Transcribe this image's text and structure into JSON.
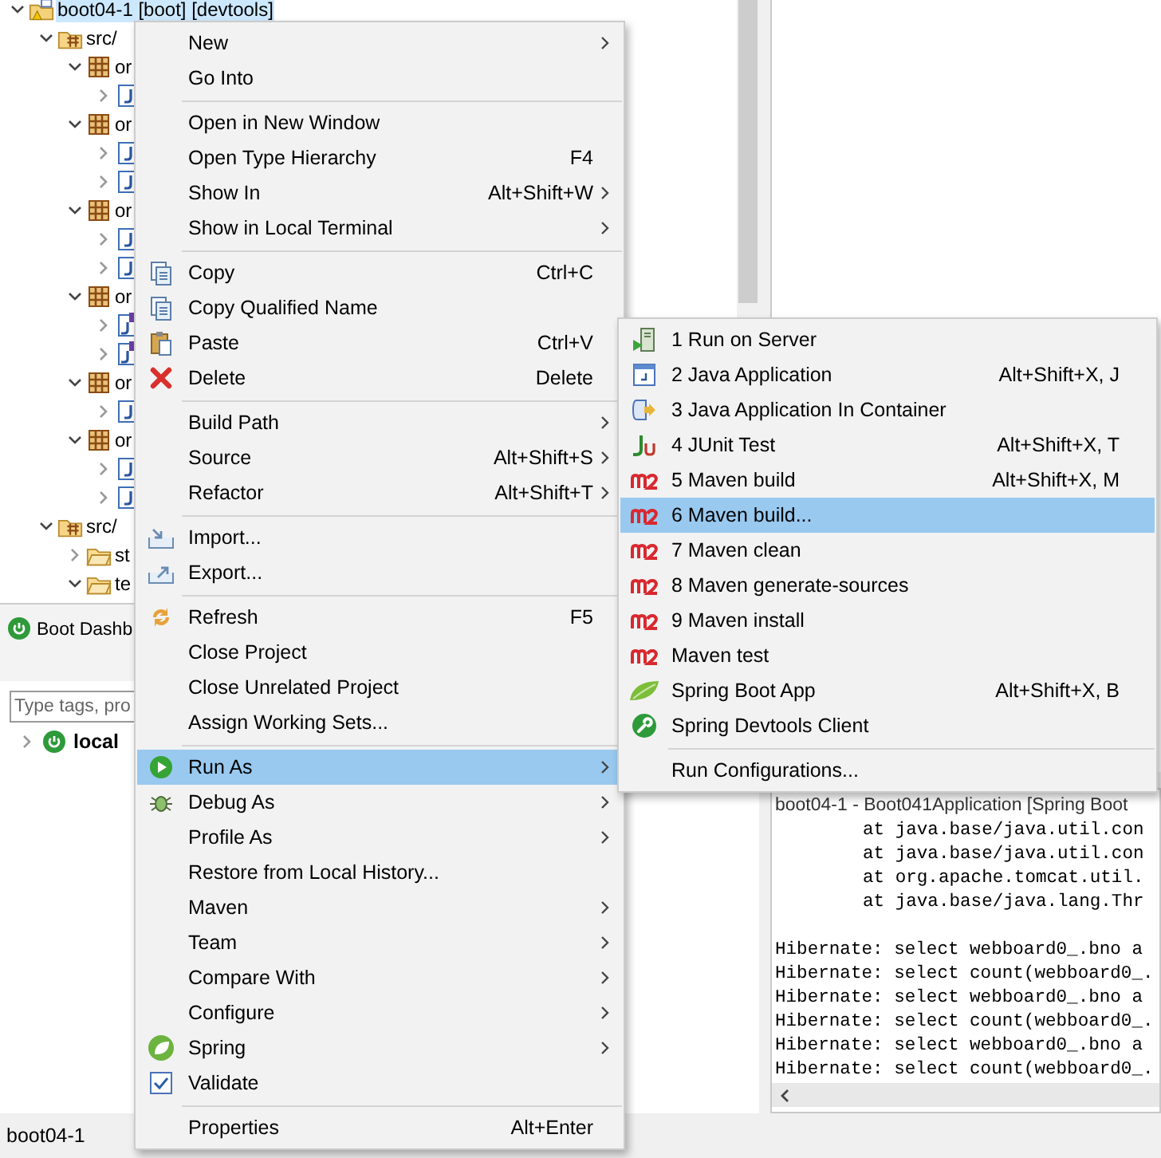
{
  "explorer": {
    "tree": [
      {
        "kind": "project",
        "label": "boot04-1 [boot] [devtools]",
        "selected": true,
        "expanded": true,
        "children": [
          {
            "kind": "source-folder",
            "label": "src/",
            "selected": false,
            "expanded": true,
            "children": [
              {
                "kind": "package",
                "label": "or",
                "selected": false,
                "expanded": true,
                "children": [
                  {
                    "kind": "class",
                    "expanded": false
                  }
                ]
              },
              {
                "kind": "package",
                "label": "or",
                "selected": false,
                "expanded": true,
                "children": [
                  {
                    "kind": "class",
                    "expanded": false
                  },
                  {
                    "kind": "class",
                    "expanded": false
                  }
                ]
              },
              {
                "kind": "package",
                "label": "or",
                "selected": false,
                "expanded": true,
                "children": [
                  {
                    "kind": "class",
                    "expanded": false
                  },
                  {
                    "kind": "class",
                    "expanded": false
                  }
                ]
              },
              {
                "kind": "package",
                "label": "or",
                "selected": false,
                "expanded": true,
                "children": [
                  {
                    "kind": "interface",
                    "expanded": false
                  },
                  {
                    "kind": "interface",
                    "expanded": false
                  }
                ]
              },
              {
                "kind": "package",
                "label": "or",
                "selected": false,
                "expanded": true,
                "children": [
                  {
                    "kind": "class",
                    "expanded": false
                  }
                ]
              },
              {
                "kind": "package",
                "label": "or",
                "selected": false,
                "expanded": true,
                "children": [
                  {
                    "kind": "class",
                    "expanded": false
                  },
                  {
                    "kind": "class",
                    "expanded": false
                  }
                ]
              }
            ]
          },
          {
            "kind": "source-folder",
            "label": "src/",
            "selected": false,
            "expanded": true,
            "children": [
              {
                "kind": "folder",
                "label": "st",
                "selected": false,
                "expanded": false
              },
              {
                "kind": "folder",
                "label": "te",
                "selected": false,
                "expanded": true
              }
            ]
          }
        ]
      }
    ]
  },
  "boot_dashboard": {
    "title": "Boot Dashb",
    "search": {
      "placeholder": "Type tags, pro"
    },
    "tree": [
      {
        "label": "local",
        "expanded": false,
        "selected": false
      }
    ]
  },
  "console": {
    "title": "boot04-1 - Boot041Application [Spring Boot",
    "lines": [
      {
        "kind": "trace",
        "text": "at java.base/java.util.con"
      },
      {
        "kind": "trace",
        "text": "at java.base/java.util.con"
      },
      {
        "kind": "trace",
        "text": "at org.apache.tomcat.util."
      },
      {
        "kind": "trace",
        "text": "at java.base/java.lang.Thr"
      },
      {
        "kind": "log",
        "text": "Hibernate: select webboard0_.bno a"
      },
      {
        "kind": "log",
        "text": "Hibernate: select count(webboard0_."
      },
      {
        "kind": "log",
        "text": "Hibernate: select webboard0_.bno a"
      },
      {
        "kind": "log",
        "text": "Hibernate: select count(webboard0_."
      },
      {
        "kind": "log",
        "text": "Hibernate: select webboard0_.bno a"
      },
      {
        "kind": "log",
        "text": "Hibernate: select count(webboard0_."
      }
    ]
  },
  "status_bar": {
    "text": "boot04-1"
  },
  "menu": {
    "items": [
      {
        "kind": "item",
        "label": "New",
        "submenu": true,
        "selected": false
      },
      {
        "kind": "item",
        "label": "Go Into",
        "submenu": false,
        "selected": false
      },
      {
        "kind": "separator"
      },
      {
        "kind": "item",
        "label": "Open in New Window",
        "submenu": false,
        "selected": false
      },
      {
        "kind": "item",
        "label": "Open Type Hierarchy",
        "shortcut": "F4",
        "submenu": false,
        "selected": false
      },
      {
        "kind": "item",
        "label": "Show In",
        "shortcut": "Alt+Shift+W",
        "submenu": true,
        "selected": false
      },
      {
        "kind": "item",
        "label": "Show in Local Terminal",
        "submenu": true,
        "selected": false
      },
      {
        "kind": "separator"
      },
      {
        "kind": "item",
        "label": "Copy",
        "shortcut": "Ctrl+C",
        "submenu": false,
        "selected": false
      },
      {
        "kind": "item",
        "label": "Copy Qualified Name",
        "submenu": false,
        "selected": false
      },
      {
        "kind": "item",
        "label": "Paste",
        "shortcut": "Ctrl+V",
        "submenu": false,
        "selected": false
      },
      {
        "kind": "item",
        "label": "Delete",
        "shortcut": "Delete",
        "submenu": false,
        "selected": false
      },
      {
        "kind": "separator"
      },
      {
        "kind": "item",
        "label": "Build Path",
        "submenu": true,
        "selected": false
      },
      {
        "kind": "item",
        "label": "Source",
        "shortcut": "Alt+Shift+S",
        "submenu": true,
        "selected": false
      },
      {
        "kind": "item",
        "label": "Refactor",
        "shortcut": "Alt+Shift+T",
        "submenu": true,
        "selected": false
      },
      {
        "kind": "separator"
      },
      {
        "kind": "item",
        "label": "Import...",
        "submenu": false,
        "selected": false
      },
      {
        "kind": "item",
        "label": "Export...",
        "submenu": false,
        "selected": false
      },
      {
        "kind": "separator"
      },
      {
        "kind": "item",
        "label": "Refresh",
        "shortcut": "F5",
        "submenu": false,
        "selected": false
      },
      {
        "kind": "item",
        "label": "Close Project",
        "submenu": false,
        "selected": false
      },
      {
        "kind": "item",
        "label": "Close Unrelated Project",
        "submenu": false,
        "selected": false
      },
      {
        "kind": "item",
        "label": "Assign Working Sets...",
        "submenu": false,
        "selected": false
      },
      {
        "kind": "separator"
      },
      {
        "kind": "item",
        "label": "Run As",
        "submenu": true,
        "selected": true
      },
      {
        "kind": "item",
        "label": "Debug As",
        "submenu": true,
        "selected": false
      },
      {
        "kind": "item",
        "label": "Profile As",
        "submenu": true,
        "selected": false
      },
      {
        "kind": "item",
        "label": "Restore from Local History...",
        "submenu": false,
        "selected": false
      },
      {
        "kind": "item",
        "label": "Maven",
        "submenu": true,
        "selected": false
      },
      {
        "kind": "item",
        "label": "Team",
        "submenu": true,
        "selected": false
      },
      {
        "kind": "item",
        "label": "Compare With",
        "submenu": true,
        "selected": false
      },
      {
        "kind": "item",
        "label": "Configure",
        "submenu": true,
        "selected": false
      },
      {
        "kind": "item",
        "label": "Spring",
        "submenu": true,
        "selected": false
      },
      {
        "kind": "item",
        "label": "Validate",
        "submenu": false,
        "selected": false
      },
      {
        "kind": "separator"
      },
      {
        "kind": "item",
        "label": "Properties",
        "shortcut": "Alt+Enter",
        "submenu": false,
        "selected": false
      }
    ]
  },
  "submenu": {
    "items": [
      {
        "kind": "item",
        "label": "1 Run on Server",
        "submenu": false,
        "selected": false
      },
      {
        "kind": "item",
        "label": "2 Java Application",
        "shortcut": "Alt+Shift+X, J",
        "submenu": false,
        "selected": false
      },
      {
        "kind": "item",
        "label": "3 Java Application In Container",
        "submenu": false,
        "selected": false
      },
      {
        "kind": "item",
        "label": "4 JUnit Test",
        "shortcut": "Alt+Shift+X, T",
        "submenu": false,
        "selected": false
      },
      {
        "kind": "item",
        "label": "5 Maven build",
        "shortcut": "Alt+Shift+X, M",
        "submenu": false,
        "selected": false
      },
      {
        "kind": "item",
        "label": "6 Maven build...",
        "submenu": false,
        "selected": true
      },
      {
        "kind": "item",
        "label": "7 Maven clean",
        "submenu": false,
        "selected": false
      },
      {
        "kind": "item",
        "label": "8 Maven generate-sources",
        "submenu": false,
        "selected": false
      },
      {
        "kind": "item",
        "label": "9 Maven install",
        "submenu": false,
        "selected": false
      },
      {
        "kind": "item",
        "label": "Maven test",
        "submenu": false,
        "selected": false
      },
      {
        "kind": "item",
        "label": "Spring Boot App",
        "shortcut": "Alt+Shift+X, B",
        "submenu": false,
        "selected": false
      },
      {
        "kind": "item",
        "label": "Spring Devtools Client",
        "submenu": false,
        "selected": false
      },
      {
        "kind": "separator"
      },
      {
        "kind": "item",
        "label": "Run Configurations...",
        "submenu": false,
        "selected": false
      }
    ]
  }
}
